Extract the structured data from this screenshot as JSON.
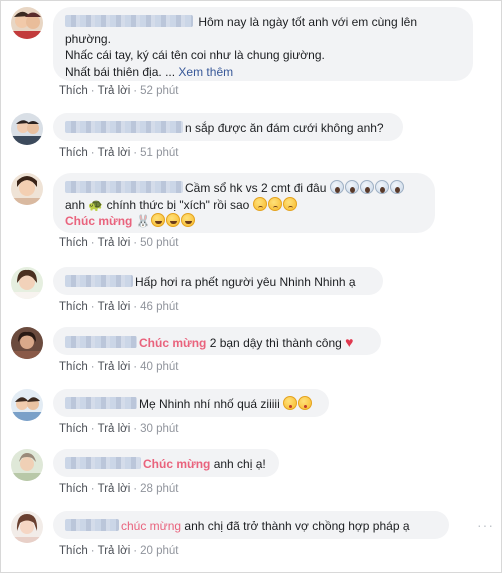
{
  "actions": {
    "like": "Thích",
    "reply": "Trả lời",
    "separator": "·"
  },
  "comments": [
    {
      "lines": [
        "Hôm nay là ngày tốt anh với em cùng lên phường.",
        "Nhấc cái tay, ký cái tên coi như là chung giường.",
        "Nhất bái thiên địa. ..."
      ],
      "see_more": "Xem thêm",
      "time": "52 phút"
    },
    {
      "text": "n sắp được ăn đám cưới không anh?",
      "time": "51 phút"
    },
    {
      "line1": "Cầm sổ hk vs 2 cmt đi đâu",
      "line2a": "anh",
      "line2b": "chính thức bị \"xích\" rồi sao",
      "line3": "Chúc mừng",
      "time": "50 phút"
    },
    {
      "text": "Hấp hơi ra phết người yêu Nhinh Nhinh ạ",
      "time": "46 phút"
    },
    {
      "highlight": "Chúc mừng",
      "text": "2 bạn dậy thì thành công",
      "time": "40 phút"
    },
    {
      "text": "Mẹ Nhinh nhí nhố quá ziiiii",
      "time": "30 phút"
    },
    {
      "highlight": "Chúc mừng",
      "text": "anh chị ạ!",
      "time": "28 phút"
    },
    {
      "highlight": "chúc mừng",
      "text": "anh chị đã trở thành vợ chồng hợp pháp ạ",
      "time": "20 phút",
      "options": "···"
    }
  ],
  "colors": {
    "bubble": "#f2f3f5",
    "highlight": "#e9637d",
    "link": "#385898",
    "meta": "#90949c"
  },
  "icons": [
    "scream-emoji",
    "turtle-emoji",
    "sad-emoji",
    "bunny-emoji",
    "grin-emoji",
    "heart-emoji",
    "kiss-emoji"
  ]
}
